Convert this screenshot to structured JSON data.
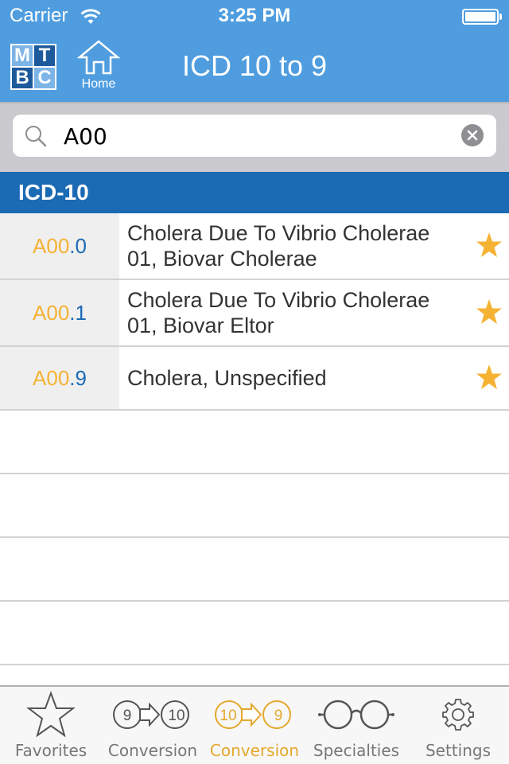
{
  "status_bar": {
    "carrier": "Carrier",
    "time": "3:25 PM",
    "battery_level": 1.0
  },
  "nav": {
    "logo_letters": [
      "M",
      "T",
      "B",
      "C"
    ],
    "home_label": "Home",
    "title": "ICD 10 to 9"
  },
  "search": {
    "value": "A00",
    "placeholder": ""
  },
  "section": {
    "title": "ICD-10"
  },
  "results": [
    {
      "code_main": "A00",
      "code_ext": ".0",
      "description": "Cholera Due To Vibrio Cholerae 01, Biovar Cholerae",
      "favorite": true
    },
    {
      "code_main": "A00",
      "code_ext": ".1",
      "description": "Cholera Due To Vibrio Cholerae 01, Biovar Eltor",
      "favorite": true
    },
    {
      "code_main": "A00",
      "code_ext": ".9",
      "description": "Cholera, Unspecified",
      "favorite": true
    }
  ],
  "tabs": [
    {
      "label": "Favorites",
      "icon": "star-outline-icon",
      "active": false
    },
    {
      "label": "Conversion",
      "icon": "convert-9-to-10-icon",
      "from": "9",
      "to": "10",
      "active": false
    },
    {
      "label": "Conversion",
      "icon": "convert-10-to-9-icon",
      "from": "10",
      "to": "9",
      "active": true
    },
    {
      "label": "Specialties",
      "icon": "glasses-icon",
      "active": false
    },
    {
      "label": "Settings",
      "icon": "gear-icon",
      "active": false
    }
  ],
  "colors": {
    "nav_blue": "#4f9ddf",
    "section_blue": "#1b6ab4",
    "accent_gold": "#f5b233",
    "tab_active": "#e5a82d",
    "tab_inactive": "#777777"
  }
}
